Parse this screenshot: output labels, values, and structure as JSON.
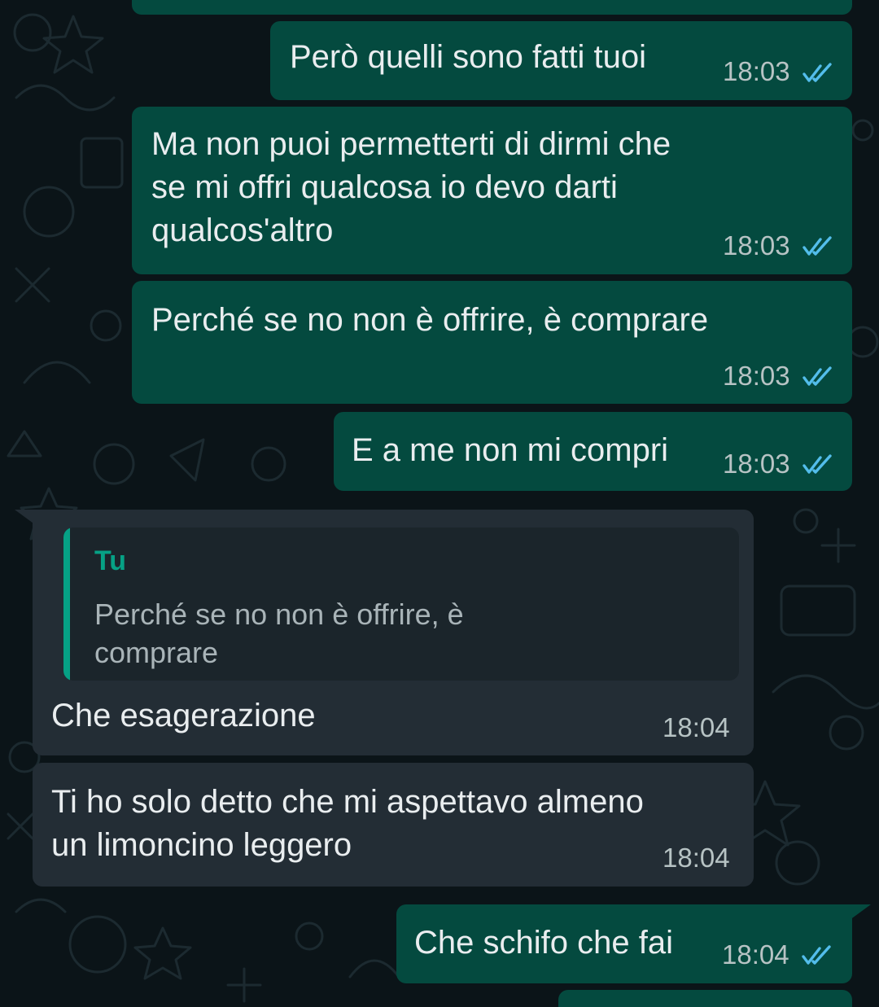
{
  "chat": {
    "messages": [
      {
        "direction": "outgoing",
        "text": "",
        "time": "",
        "status": "read"
      },
      {
        "direction": "outgoing",
        "text": "Però quelli sono fatti tuoi",
        "time": "18:03",
        "status": "read"
      },
      {
        "direction": "outgoing",
        "text": "Ma non puoi permetterti di dirmi che\nse mi offri qualcosa io devo darti\nqualcos'altro",
        "time": "18:03",
        "status": "read"
      },
      {
        "direction": "outgoing",
        "text": "Perché se no non è offrire, è comprare",
        "time": "18:03",
        "status": "read"
      },
      {
        "direction": "outgoing",
        "text": "E a me non mi compri",
        "time": "18:03",
        "status": "read"
      },
      {
        "direction": "incoming",
        "reply_to": {
          "author": "Tu",
          "text": "Perché se no non è offrire, è\ncomprare"
        },
        "text": "Che esagerazione",
        "time": "18:04"
      },
      {
        "direction": "incoming",
        "text": "Ti ho solo detto che mi aspettavo almeno\nun limoncino leggero",
        "time": "18:04"
      },
      {
        "direction": "outgoing",
        "text": "Che schifo che fai",
        "time": "18:04",
        "status": "read"
      },
      {
        "direction": "outgoing",
        "text": "",
        "time": "",
        "status": ""
      }
    ]
  },
  "colors": {
    "background": "#0b1418",
    "outgoing_bubble": "#044a3f",
    "incoming_bubble": "#232d35",
    "reply_accent": "#06a185",
    "read_ticks": "#53bdeb"
  },
  "icons": {
    "read_status": "double-check-icon"
  }
}
